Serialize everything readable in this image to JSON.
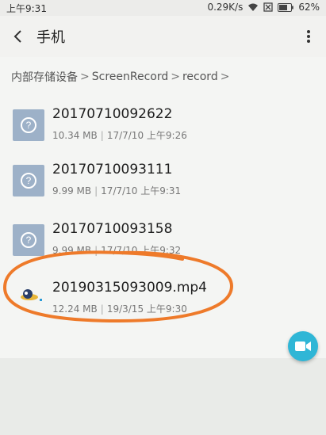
{
  "status_bar": {
    "time": "上午9:31",
    "network_speed": "0.29K/s",
    "battery_percent": "62%"
  },
  "app_bar": {
    "title": "手机"
  },
  "breadcrumb": [
    "内部存储设备",
    "ScreenRecord",
    "record"
  ],
  "files": [
    {
      "name": "20170710092622",
      "size": "10.34 MB",
      "date": "17/7/10 上午9:26"
    },
    {
      "name": "20170710093111",
      "size": "9.99 MB",
      "date": "17/7/10 上午9:31"
    },
    {
      "name": "20170710093158",
      "size": "9.99 MB",
      "date": "17/7/10 上午9:32"
    },
    {
      "name": "20190315093009.mp4",
      "size": "12.24 MB",
      "date": "19/3/15 上午9:30"
    }
  ]
}
